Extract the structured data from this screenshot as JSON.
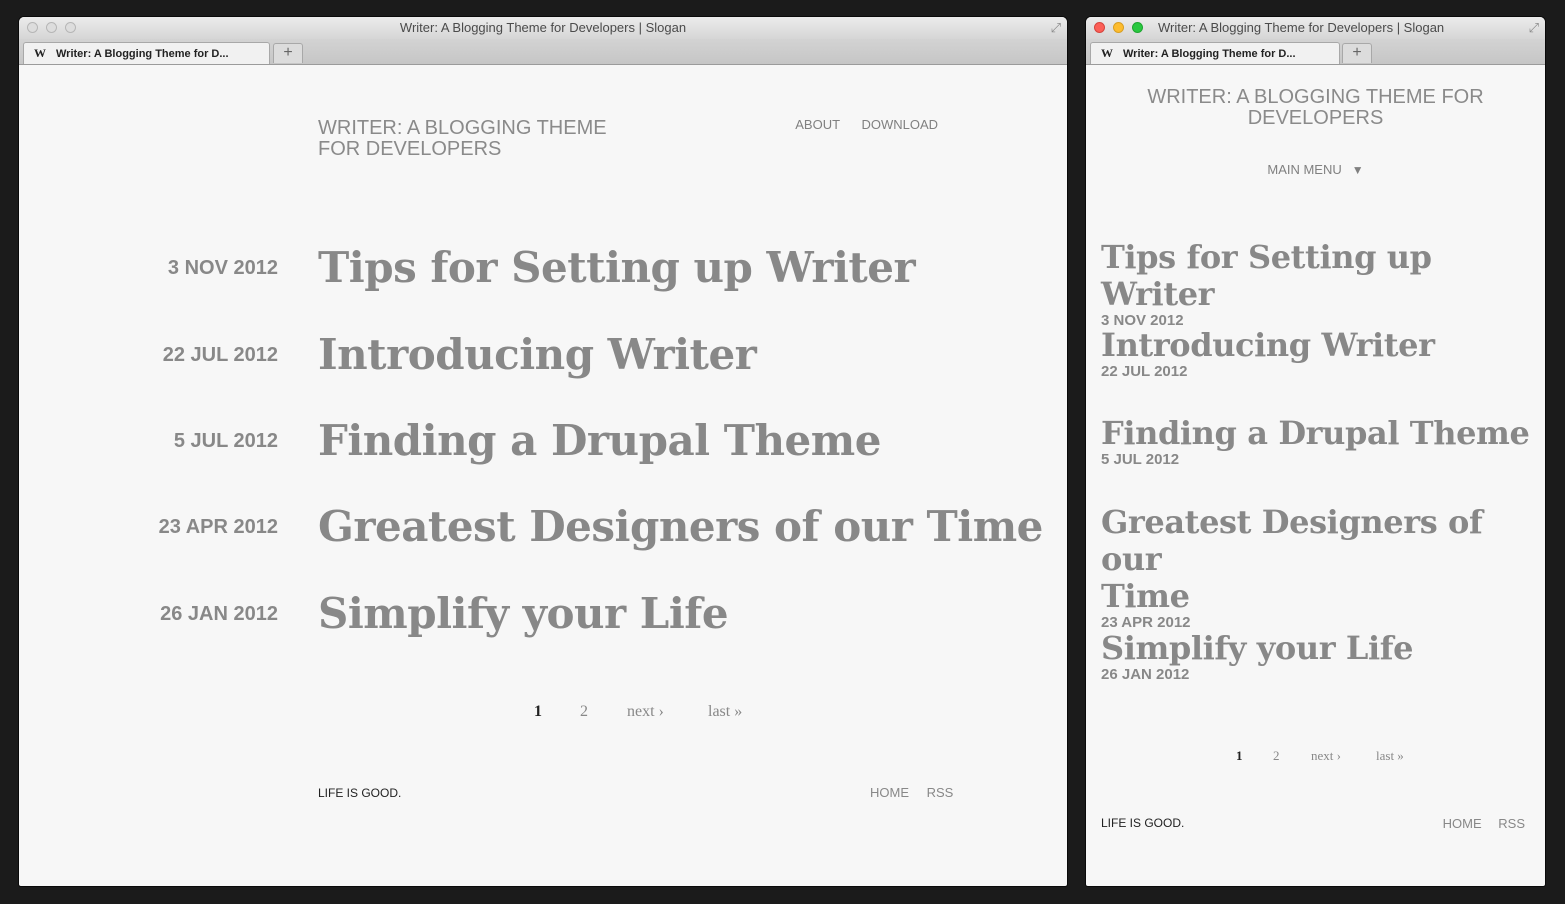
{
  "window_title": "Writer: A Blogging Theme for Developers | Slogan",
  "tab_label": "Writer: A Blogging Theme for D...",
  "favicon_letter": "W",
  "new_tab": "+",
  "fullscreen_glyph": "⤢",
  "site": {
    "title_line1": "WRITER: A BLOGGING THEME",
    "title_line2": "FOR DEVELOPERS",
    "title_mobile_line1": "WRITER: A BLOGGING THEME FOR",
    "title_mobile_line2": "DEVELOPERS"
  },
  "nav": {
    "about": "ABOUT",
    "download": "DOWNLOAD"
  },
  "main_menu": {
    "label": "MAIN MENU",
    "toggle": "▼"
  },
  "posts": [
    {
      "date": "3 NOV 2012",
      "title": "Tips for Setting up Writer"
    },
    {
      "date": "22 JUL 2012",
      "title": "Introducing Writer"
    },
    {
      "date": "5 JUL 2012",
      "title": "Finding a Drupal Theme"
    },
    {
      "date": "23 APR 2012",
      "title": "Greatest Designers of our Time",
      "title_mobile_line1": "Greatest Designers of our",
      "title_mobile_line2": "Time"
    },
    {
      "date": "26 JAN 2012",
      "title": "Simplify your Life"
    }
  ],
  "pager": {
    "current": "1",
    "page2": "2",
    "next": "next ›",
    "last": "last »"
  },
  "footer": {
    "slogan": "LIFE IS GOOD.",
    "home": "HOME",
    "rss": "RSS"
  }
}
